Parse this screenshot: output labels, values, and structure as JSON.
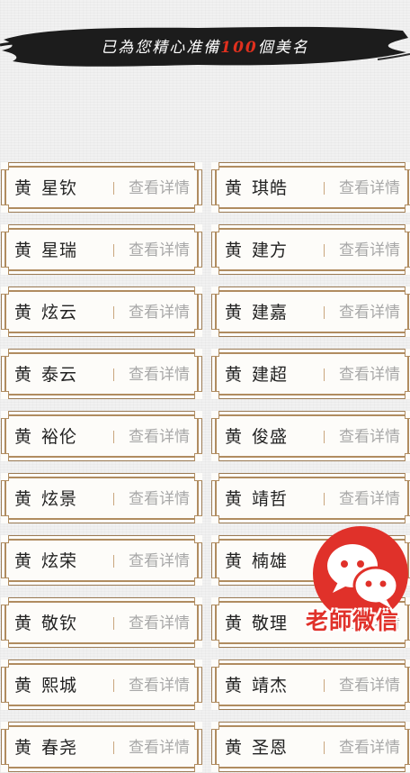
{
  "banner": {
    "text_before": "已為您精心准備",
    "highlight": "100",
    "text_after": "個美名"
  },
  "surname": "黄",
  "detail_label": "查看详情",
  "names": [
    [
      "星钦",
      "琪皓"
    ],
    [
      "星瑞",
      "建方"
    ],
    [
      "炫云",
      "建嘉"
    ],
    [
      "泰云",
      "建超"
    ],
    [
      "裕伦",
      "俊盛"
    ],
    [
      "炫景",
      "靖哲"
    ],
    [
      "炫荣",
      "楠雄"
    ],
    [
      "敬钦",
      "敬理"
    ],
    [
      "熙城",
      "靖杰"
    ],
    [
      "春尧",
      "圣恩"
    ]
  ],
  "wechat": {
    "label": "老師微信",
    "icon": "wechat-icon"
  },
  "colors": {
    "accent": "#e0301e",
    "card_border": "#9b7b55",
    "detail_text": "#a8a8a8"
  }
}
